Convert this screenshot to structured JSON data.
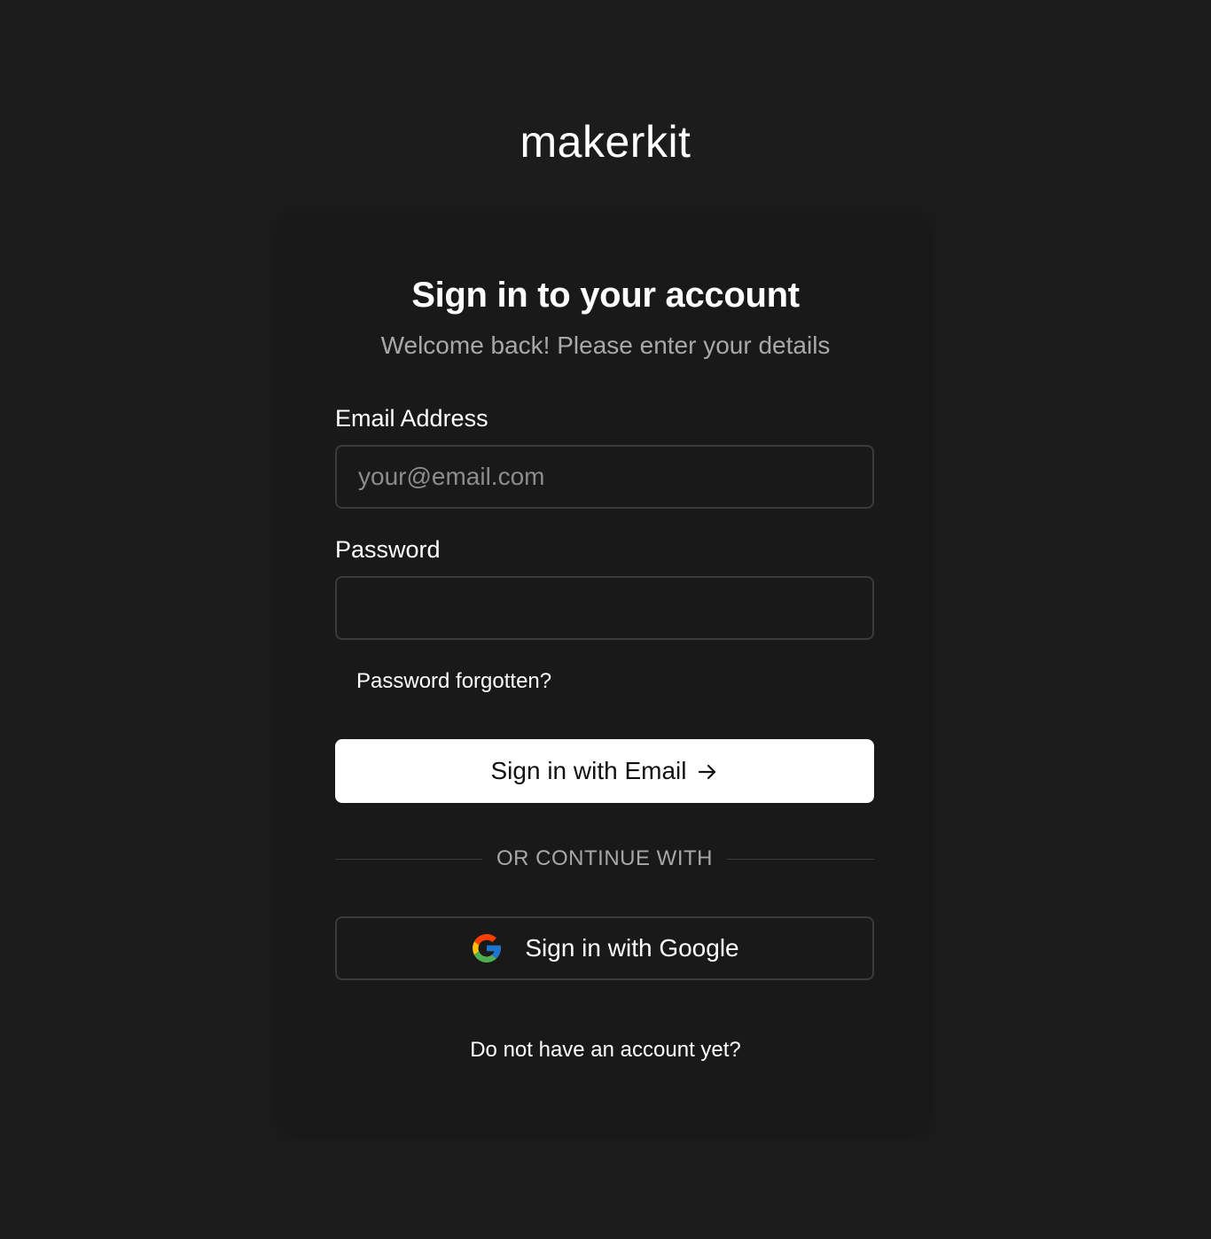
{
  "app": {
    "logo_text": "makerkit"
  },
  "signin": {
    "title": "Sign in to your account",
    "subtitle": "Welcome back! Please enter your details",
    "email": {
      "label": "Email Address",
      "placeholder": "your@email.com",
      "value": ""
    },
    "password": {
      "label": "Password",
      "placeholder": "",
      "value": ""
    },
    "forgot_password_link": "Password forgotten?",
    "email_button_label": "Sign in with Email",
    "divider_text": "OR CONTINUE WITH",
    "google_button_label": "Sign in with Google",
    "signup_link": "Do not have an account yet?"
  },
  "icons": {
    "email_button_icon": "arrow-right-icon",
    "google_button_icon": "google-icon"
  },
  "colors": {
    "page_background": "#1c1c1c",
    "card_background": "#191919",
    "primary_button_background": "#ffffff",
    "primary_button_text": "#111111",
    "border": "#3b3b3b",
    "muted_text": "#a8a8a8"
  }
}
